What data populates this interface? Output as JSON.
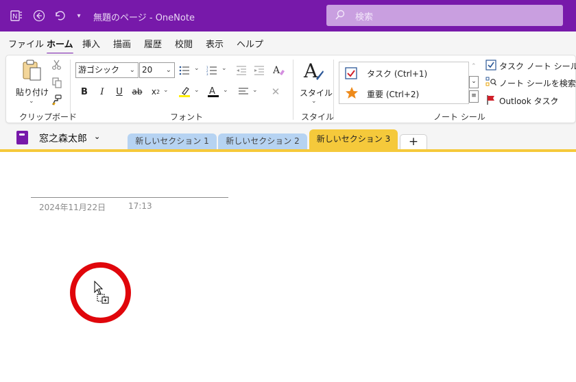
{
  "titlebar": {
    "title": "無題のページ  -  OneNote",
    "search_placeholder": "検索",
    "bg_color": "#7719aa"
  },
  "menu": {
    "tabs": [
      {
        "label": "ファイル",
        "active": false
      },
      {
        "label": "ホーム",
        "active": true
      },
      {
        "label": "挿入",
        "active": false
      },
      {
        "label": "描画",
        "active": false
      },
      {
        "label": "履歴",
        "active": false
      },
      {
        "label": "校閲",
        "active": false
      },
      {
        "label": "表示",
        "active": false
      },
      {
        "label": "ヘルプ",
        "active": false
      }
    ]
  },
  "ribbon": {
    "clipboard": {
      "paste_label": "貼り付け",
      "group_label": "クリップボード"
    },
    "font": {
      "font_name": "游ゴシック",
      "font_size": "20",
      "group_label": "フォント"
    },
    "styles": {
      "button_label": "スタイル",
      "group_label": "スタイル"
    },
    "tags": {
      "items": [
        {
          "label": "タスク (Ctrl+1)",
          "icon": "checkbox-icon"
        },
        {
          "label": "重要 (Ctrl+2)",
          "icon": "star-icon"
        }
      ],
      "group_label": "ノート シール",
      "actions": [
        {
          "label": "タスク ノート シール",
          "icon": "task-tag-icon"
        },
        {
          "label": "ノート シールを検索",
          "icon": "find-tags-icon"
        },
        {
          "label": "Outlook タスク",
          "icon": "flag-icon"
        }
      ]
    }
  },
  "notebook": {
    "name": "窓之森太郎",
    "sections": [
      {
        "label": "新しいセクション 1",
        "color": "#b6d3f2",
        "active": false
      },
      {
        "label": "新しいセクション 2",
        "color": "#b6d3f2",
        "active": false
      },
      {
        "label": "新しいセクション 3",
        "color": "#f5c93b",
        "active": true
      }
    ],
    "add_label": "+"
  },
  "page": {
    "date": "2024年11月22日",
    "time": "17:13"
  },
  "colors": {
    "accent": "#7719aa",
    "section_active": "#f5c93b",
    "section_inactive": "#b6d3f2",
    "highlight_circle": "#e0060b"
  }
}
